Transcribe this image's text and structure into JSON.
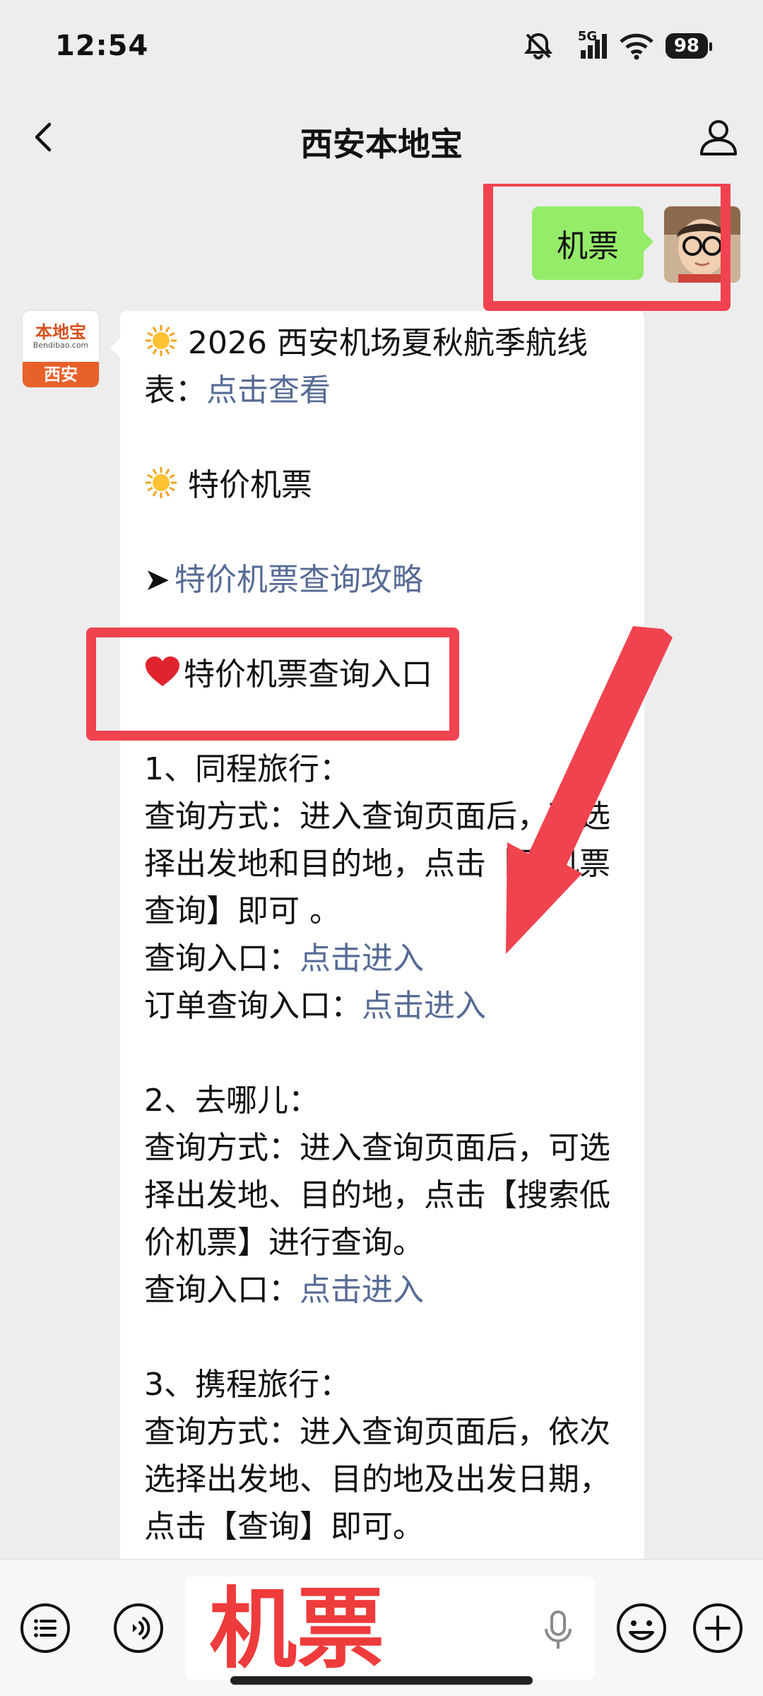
{
  "status_bar": {
    "time": "12:54",
    "network": "5G",
    "battery": "98",
    "icons": [
      "mute-icon",
      "signal-icon",
      "wifi-icon",
      "battery-icon"
    ]
  },
  "nav": {
    "title": "西安本地宝",
    "back_icon": "chevron-left-icon",
    "profile_icon": "user-icon"
  },
  "sent_message": {
    "text": "机票",
    "avatar": "user-avatar"
  },
  "bot": {
    "avatar_name": "本地宝",
    "avatar_sub": "Bendibao.com",
    "avatar_city": "西安"
  },
  "reply": {
    "lines": [
      {
        "segments": [
          {
            "text": "2026 西安机场夏秋航季航线",
            "link": false
          }
        ],
        "icon": "sun-icon"
      },
      {
        "segments": [
          {
            "text": "表：",
            "link": false
          },
          {
            "text": "点击查看",
            "link": true
          }
        ]
      },
      {
        "segments": []
      },
      {
        "segments": [
          {
            "text": "特价机票",
            "link": false
          }
        ],
        "icon": "sun-icon"
      },
      {
        "segments": []
      },
      {
        "segments": [
          {
            "text": "特价机票查询攻略",
            "link": true
          }
        ],
        "icon": "arrow-icon"
      },
      {
        "segments": []
      },
      {
        "segments": [
          {
            "text": "特价机票查询入口",
            "link": false
          }
        ],
        "icon": "heart-icon"
      },
      {
        "segments": []
      },
      {
        "segments": [
          {
            "text": "1、同程旅行：",
            "link": false
          }
        ]
      },
      {
        "segments": [
          {
            "text": "查询方式：进入查询页面后，可选",
            "link": false
          }
        ]
      },
      {
        "segments": [
          {
            "text": "择出发地和目的地，点击【飞机票",
            "link": false
          }
        ]
      },
      {
        "segments": [
          {
            "text": "查询】即可 。",
            "link": false
          }
        ]
      },
      {
        "segments": [
          {
            "text": "查询入口：",
            "link": false
          },
          {
            "text": "点击进入",
            "link": true
          }
        ]
      },
      {
        "segments": [
          {
            "text": "订单查询入口：",
            "link": false
          },
          {
            "text": "点击进入",
            "link": true
          }
        ]
      },
      {
        "segments": []
      },
      {
        "segments": [
          {
            "text": "2、去哪儿：",
            "link": false
          }
        ]
      },
      {
        "segments": [
          {
            "text": "查询方式：进入查询页面后，可选",
            "link": false
          }
        ]
      },
      {
        "segments": [
          {
            "text": "择出发地、目的地，点击【搜索低",
            "link": false
          }
        ]
      },
      {
        "segments": [
          {
            "text": "价机票】进行查询。",
            "link": false
          }
        ]
      },
      {
        "segments": [
          {
            "text": "查询入口：",
            "link": false
          },
          {
            "text": "点击进入",
            "link": true
          }
        ]
      },
      {
        "segments": []
      },
      {
        "segments": [
          {
            "text": "3、携程旅行：",
            "link": false
          }
        ]
      },
      {
        "segments": [
          {
            "text": "查询方式：进入查询页面后，依次",
            "link": false
          }
        ]
      },
      {
        "segments": [
          {
            "text": "选择出发地、目的地及出发日期，",
            "link": false
          }
        ]
      },
      {
        "segments": [
          {
            "text": "点击【查询】即可。",
            "link": false
          }
        ]
      }
    ]
  },
  "input_bar": {
    "text": "机票",
    "left_icons": [
      "menu-list-icon",
      "voice-wave-icon"
    ],
    "right_icons": [
      "emoji-icon",
      "plus-icon"
    ],
    "mic_icon": "microphone-icon"
  },
  "colors": {
    "highlight": "#f0434f",
    "link": "#576b95",
    "sent_bubble": "#95ec69",
    "background": "#ededed"
  }
}
